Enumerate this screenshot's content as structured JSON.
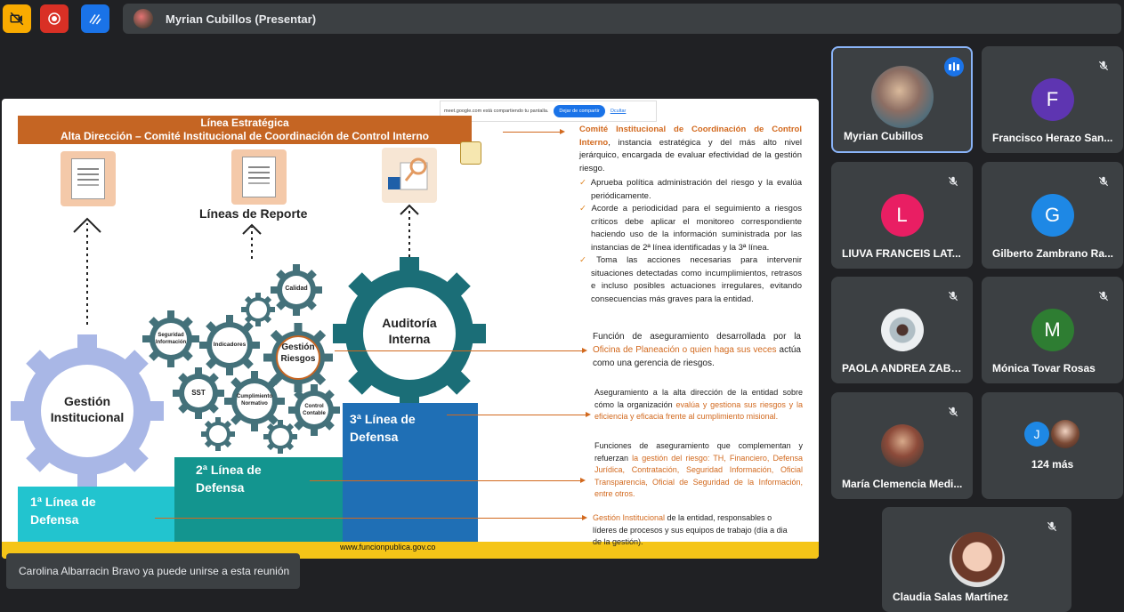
{
  "meeting": {
    "presenter_label": "Myrian Cubillos (Presentar)",
    "toast": "Carolina Albarracin Bravo ya puede unirse a esta reunión"
  },
  "colors": {
    "bg": "#202124",
    "tile": "#3c4043",
    "active_border": "#8ab4f8",
    "camera_off_btn": "#f9ab00",
    "record_btn": "#d93025",
    "whiteboard_btn": "#1a73e8"
  },
  "share_banner": {
    "text": "meet.google.com está compartiendo tu pantalla.",
    "stop_label": "Dejar de compartir",
    "hide_label": "Ocultar"
  },
  "slide": {
    "strategic_line_1": "Línea Estratégica",
    "strategic_line_2": "Alta Dirección – Comité Institucional de Coordinación de Control Interno",
    "reporting_lines": "Líneas de Reporte",
    "gears": {
      "gestion_institucional": "Gestión Institucional",
      "auditoria_interna": "Auditoría Interna",
      "gestion_riesgos": "Gestión Riesgos",
      "calidad": "Calidad",
      "seguridad_informacion": "Seguridad Información",
      "indicadores": "Indicadores",
      "sst": "SST",
      "cumplimiento_normativo": "Cumplimiento Normativo",
      "control_contable": "Control Contable"
    },
    "levels": {
      "first": "1ª Línea de Defensa",
      "second": "2ª Línea de Defensa",
      "third": "3ª Línea de Defensa"
    },
    "footer_url": "www.funcionpublica.gov.co",
    "right": {
      "committee_title": "Comité Institucional de Coordinación de Control Interno",
      "committee_desc": ", instancia estratégica y del más alto nivel jerárquico, encargada de evaluar efectividad de la gestión riesgo.",
      "bullet_1": "Aprueba política administración del riesgo y la evalúa periódicamente.",
      "bullet_2": "Acorde a periodicidad para el seguimiento a riesgos críticos debe aplicar el monitoreo correspondiente haciendo uso de la información suministrada por las instancias de 2ª línea identificadas y la 3ª línea.",
      "bullet_3": "Toma las acciones necesarias para intervenir situaciones detectadas como incumplimientos, retrasos e incluso posibles actuaciones irregulares, evitando consecuencias más graves para la entidad.",
      "risk_a": "Función de aseguramiento desarrollada por la ",
      "risk_b": "Oficina de Planeación o quien haga sus veces",
      "risk_c": " actúa como una gerencia de riesgos.",
      "third_a": "Aseguramiento a la alta dirección de la entidad sobre cómo la organización ",
      "third_b": "evalúa y gestiona sus riesgos y la eficiencia y eficacia frente al cumplimiento misional.",
      "second_a": "Funciones de aseguramiento que complementan y refuerzan ",
      "second_b": "la gestión del riesgo: TH, Financiero, Defensa Jurídica, Contratación, Seguridad Información, Oficial Transparencia, Oficial de Seguridad de la Información, entre otros.",
      "first_a": "Gestión Institucional",
      "first_b": " de la entidad, responsables o líderes de procesos y sus equipos de trabajo (día a dia de la gestión)."
    }
  },
  "participants": [
    {
      "name": "Myrian Cubillos",
      "initial": "",
      "color": "",
      "speaking": true
    },
    {
      "name": "Francisco Herazo San...",
      "initial": "F",
      "color": "#5e35b1",
      "speaking": false
    },
    {
      "name": "LIUVA FRANCEIS LAT...",
      "initial": "L",
      "color": "#e91e63",
      "speaking": false
    },
    {
      "name": "Gilberto Zambrano Ra...",
      "initial": "G",
      "color": "#1e88e5",
      "speaking": false
    },
    {
      "name": "PAOLA ANDREA ZABA...",
      "initial": "",
      "color": "",
      "speaking": false
    },
    {
      "name": "Mónica Tovar Rosas",
      "initial": "M",
      "color": "#2e7d32",
      "speaking": false
    },
    {
      "name": "María Clemencia Medi...",
      "initial": "",
      "color": "",
      "speaking": false
    },
    {
      "name": "Claudia Salas Martínez",
      "initial": "",
      "color": "",
      "speaking": false
    }
  ],
  "more": {
    "initial": "J",
    "label": "124 más"
  }
}
